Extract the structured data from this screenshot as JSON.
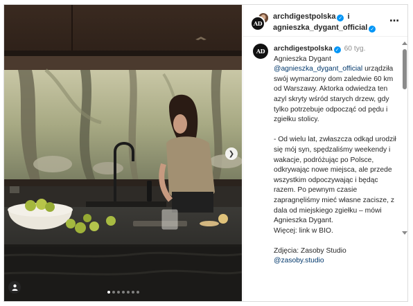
{
  "header": {
    "author": "archdigestpolska",
    "conjunction": "i",
    "collaborator": "agnieszka_dygant_official",
    "more_icon": "more-horizontal-icon"
  },
  "avatar": {
    "initials": "AD"
  },
  "caption": {
    "username": "archdigestpolska",
    "time": "60 tyg.",
    "line1": "Agnieszka Dygant",
    "mention": "@agnieszka_dygant_official",
    "para1_rest": " urządziła swój wymarzony dom zaledwie 60 km od Warszawy. Aktorka odwiedza ten azyl skryty wśród starych drzew, gdy tylko potrzebuje odpocząć od pędu i zgiełku stolicy.",
    "para2": "- Od wielu lat, zwłaszcza odkąd urodził się mój syn, spędzaliśmy weekendy i wakacje, podróżując po Polsce, odkrywając nowe miejsca, ale przede wszystkim odpoczywając i będąc razem. Po pewnym czasie zapragnęliśmy mieć własne zacisze, z dala od miejskiego zgiełku – mówi Agnieszka Dygant.",
    "para3": "Więcej: link w BIO.",
    "credit_prefix": "Zdjęcia: Zasoby Studio ",
    "credit_mention": "@zasoby.studio"
  },
  "carousel": {
    "total": 7,
    "active_index": 0
  },
  "colors": {
    "verified": "#0095f6",
    "mention": "#00376b",
    "muted": "#8e8e8e"
  }
}
